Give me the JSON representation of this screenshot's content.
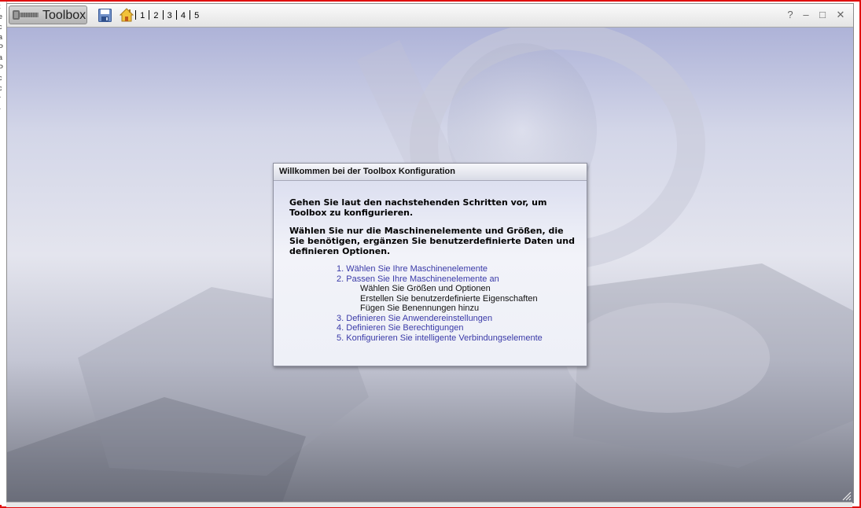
{
  "window": {
    "tab_label": "Toolbox",
    "pages": [
      "1",
      "2",
      "3",
      "4",
      "5"
    ],
    "controls": {
      "help": "?",
      "minimize": "–",
      "maximize": "□",
      "close": "✕"
    }
  },
  "left_strip": [
    "t",
    "e",
    "c",
    "a",
    "P",
    "a",
    "P",
    "",
    "c",
    "c",
    "r",
    "-"
  ],
  "dialog": {
    "title": "Willkommen bei der Toolbox Konfiguration",
    "intro1": "Gehen Sie laut den nachstehenden Schritten vor, um Toolbox zu konfigurieren.",
    "intro2": "Wählen Sie nur die Maschinenelemente und Größen, die Sie benötigen, ergänzen Sie benutzerdefinierte Daten und definieren Optionen.",
    "steps": [
      {
        "num": "1.",
        "label": "Wählen Sie Ihre Maschinenelemente"
      },
      {
        "num": "2.",
        "label": "Passen Sie Ihre Maschinenelemente an",
        "subs": [
          "Wählen Sie Größen und Optionen",
          "Erstellen Sie benutzerdefinierte Eigenschaften",
          "Fügen Sie Benennungen hinzu"
        ]
      },
      {
        "num": "3.",
        "label": "Definieren Sie Anwendereinstellungen"
      },
      {
        "num": "4.",
        "label": "Definieren Sie Berechtigungen"
      },
      {
        "num": "5.",
        "label": "Konfigurieren Sie intelligente Verbindungselemente"
      }
    ]
  },
  "colors": {
    "frame": "#e01010",
    "link": "#3a3aa8",
    "background_top": "#aeb3d8",
    "background_bottom": "#70737f"
  },
  "icons": [
    "bolt-icon",
    "save-icon",
    "home-icon",
    "help-icon",
    "minimize-icon",
    "maximize-icon",
    "close-icon",
    "resize-grip-icon"
  ]
}
